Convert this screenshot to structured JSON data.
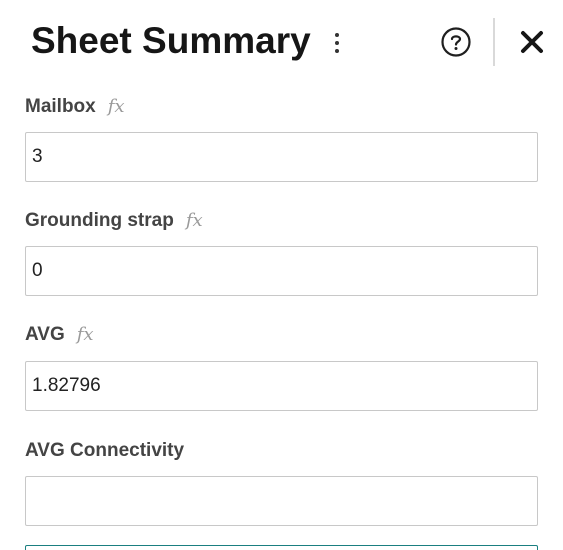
{
  "header": {
    "title": "Sheet Summary",
    "icons": {
      "more": "more-vertical-icon",
      "help": "help-circle-icon",
      "close": "close-icon"
    }
  },
  "fields": [
    {
      "label": "Mailbox",
      "has_formula": true,
      "value": "3"
    },
    {
      "label": "Grounding strap",
      "has_formula": true,
      "value": "0"
    },
    {
      "label": "AVG",
      "has_formula": true,
      "value": "1.82796"
    },
    {
      "label": "AVG Connectivity",
      "has_formula": false,
      "value": ""
    }
  ],
  "formula_icon_glyph": "fx",
  "colors": {
    "title": "#161616",
    "label": "#444444",
    "formula_icon": "#9a9a9a",
    "input_border": "#c8c8c8",
    "focused_border": "#1a7f80"
  }
}
